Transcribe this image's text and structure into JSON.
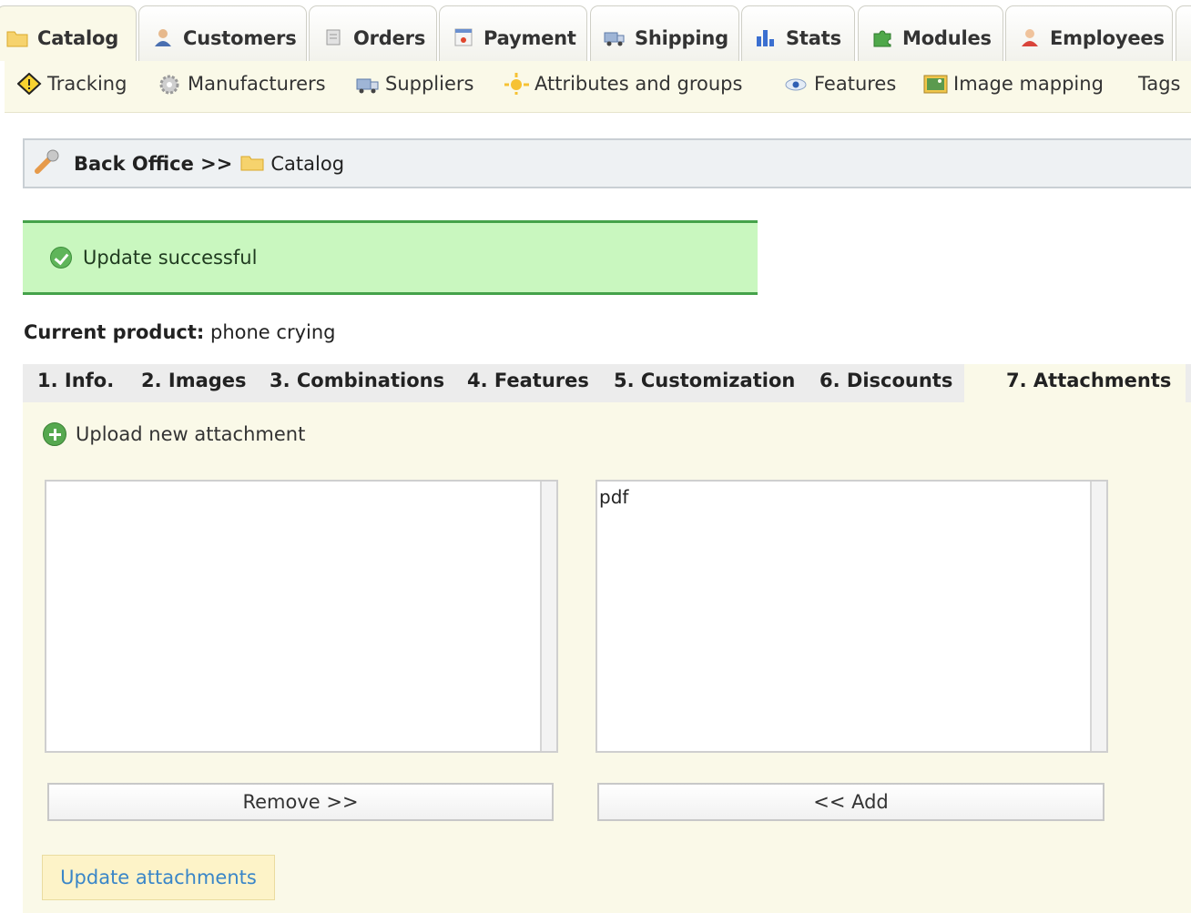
{
  "top_tabs": [
    {
      "label": "Catalog",
      "icon": "folder-icon"
    },
    {
      "label": "Customers",
      "icon": "customer-icon"
    },
    {
      "label": "Orders",
      "icon": "cart-icon"
    },
    {
      "label": "Payment",
      "icon": "payment-icon"
    },
    {
      "label": "Shipping",
      "icon": "truck-icon"
    },
    {
      "label": "Stats",
      "icon": "bar-chart-icon"
    },
    {
      "label": "Modules",
      "icon": "puzzle-icon"
    },
    {
      "label": "Employees",
      "icon": "employee-icon"
    }
  ],
  "sub_nav": [
    {
      "label": "Tracking",
      "icon": "tracking-icon"
    },
    {
      "label": "Manufacturers",
      "icon": "gear-icon"
    },
    {
      "label": "Suppliers",
      "icon": "supplier-icon"
    },
    {
      "label": "Attributes and groups",
      "icon": "sun-icon"
    },
    {
      "label": "Features",
      "icon": "eye-icon"
    },
    {
      "label": "Image mapping",
      "icon": "image-icon"
    },
    {
      "label": "Tags",
      "icon": ""
    }
  ],
  "breadcrumb": {
    "root": "Back Office >>",
    "current": "Catalog"
  },
  "success_message": "Update successful",
  "current_product": {
    "label": "Current product:",
    "name": "phone crying"
  },
  "product_tabs": [
    "1. Info.",
    "2. Images",
    "3. Combinations",
    "4. Features",
    "5. Customization",
    "6. Discounts",
    "7. Attachments"
  ],
  "active_product_tab": "7. Attachments",
  "attachments": {
    "upload_label": "Upload new attachment",
    "selected_items": [],
    "available_items": [
      "pdf"
    ],
    "remove_label": "Remove >>",
    "add_label": "<< Add",
    "update_label": "Update attachments"
  },
  "colors": {
    "success_bg": "#c9f7bf",
    "success_border": "#45a24a",
    "panel_bg": "#faf9e8",
    "link_blue": "#3a86c8"
  }
}
